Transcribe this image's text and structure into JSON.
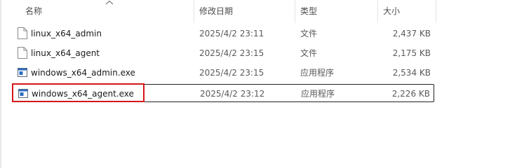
{
  "columns": {
    "name": "名称",
    "date": "修改日期",
    "type": "类型",
    "size": "大小"
  },
  "files": [
    {
      "name": "linux_x64_admin",
      "date": "2025/4/2 23:11",
      "type": "文件",
      "size": "2,437 KB",
      "icon": "document-icon"
    },
    {
      "name": "linux_x64_agent",
      "date": "2025/4/2 23:15",
      "type": "文件",
      "size": "2,175 KB",
      "icon": "document-icon"
    },
    {
      "name": "windows_x64_admin.exe",
      "date": "2025/4/2 23:15",
      "type": "应用程序",
      "size": "2,534 KB",
      "icon": "executable-icon"
    },
    {
      "name": "windows_x64_agent.exe",
      "date": "2025/4/2 23:12",
      "type": "应用程序",
      "size": "2,226 KB",
      "icon": "executable-icon"
    }
  ],
  "colors": {
    "highlight_box": "#d3171b",
    "exe_icon_blue": "#2b6cc4"
  }
}
